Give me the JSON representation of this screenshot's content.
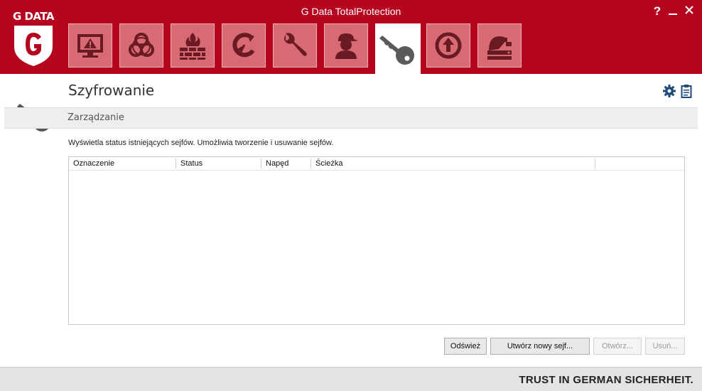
{
  "window": {
    "title": "G Data TotalProtection",
    "help_label": "?",
    "minimize_label": "—",
    "close_label": "✕"
  },
  "logo": {
    "text": "G DATA",
    "letter": "G"
  },
  "nav": {
    "tabs": [
      {
        "icon": "monitor-warning-icon"
      },
      {
        "icon": "biohazard-icon"
      },
      {
        "icon": "firewall-icon"
      },
      {
        "icon": "backup-arrow-icon"
      },
      {
        "icon": "wrench-icon"
      },
      {
        "icon": "user-cap-icon"
      },
      {
        "icon": "key-icon",
        "active": true
      },
      {
        "icon": "upload-circle-icon"
      },
      {
        "icon": "disk-shredder-icon"
      }
    ]
  },
  "header": {
    "title": "Szyfrowanie"
  },
  "section": {
    "title": "Zarządzanie",
    "description": "Wyświetla status istniejących sejfów. Umożliwia tworzenie i usuwanie sejfów."
  },
  "table": {
    "columns": [
      "Oznaczenie",
      "Status",
      "Napęd",
      "Ścieżka",
      ""
    ],
    "rows": []
  },
  "buttons": {
    "refresh": "Odśwież",
    "create": "Utwórz nowy sejf...",
    "open": "Otwórz...",
    "delete": "Usuń..."
  },
  "footer": {
    "slogan": "TRUST IN GERMAN SICHERHEIT."
  },
  "colors": {
    "brand_red": "#b5051f",
    "tab_bg": "#d86a74",
    "icon_dark": "#6a1a22"
  }
}
